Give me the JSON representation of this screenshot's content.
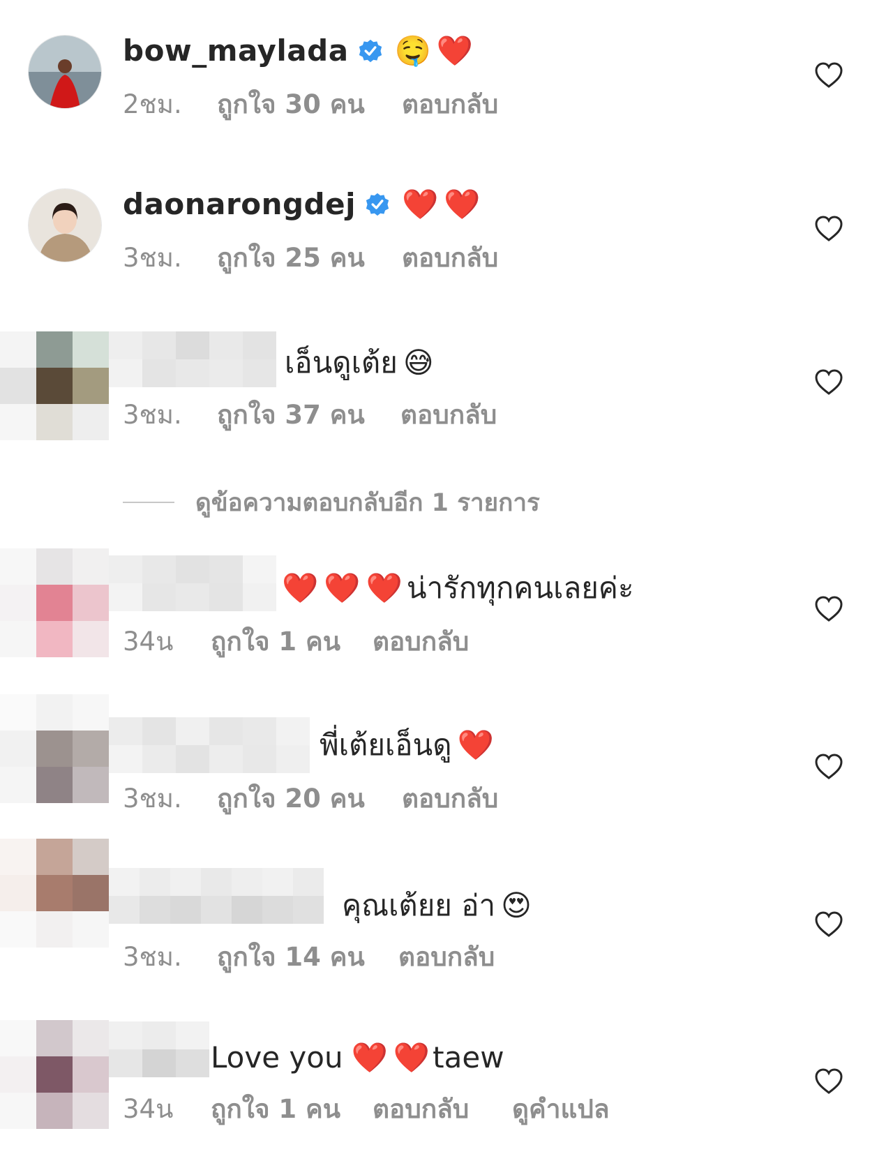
{
  "colors": {
    "verified_badge": "#3897f0",
    "heart_red": "#ed1c2e",
    "meta_gray": "#8e8e8e"
  },
  "comments": [
    {
      "username": "bow_maylada",
      "verified": true,
      "text": "",
      "emoji": [
        "🤤",
        "❤️"
      ],
      "time": "2ชม.",
      "likes": "ถูกใจ 30 คน",
      "reply": "ตอบกลับ",
      "like_icon": "heart-outline-icon"
    },
    {
      "username": "daonarongdej",
      "verified": true,
      "text": "",
      "emoji": [
        "❤️",
        "❤️"
      ],
      "time": "3ชม.",
      "likes": "ถูกใจ 25 คน",
      "reply": "ตอบกลับ",
      "like_icon": "heart-outline-icon"
    },
    {
      "username": "",
      "text": "เอ็นดูเต้ย",
      "emoji": [
        "😅"
      ],
      "time": "3ชม.",
      "likes": "ถูกใจ 37 คน",
      "reply": "ตอบกลับ",
      "like_icon": "heart-outline-icon"
    },
    {
      "username": "",
      "text": "น่ารักทุกคนเลยค่ะ",
      "emoji_before": [
        "❤️",
        "❤️",
        "❤️"
      ],
      "time": "34น",
      "likes": "ถูกใจ 1 คน",
      "reply": "ตอบกลับ",
      "like_icon": "heart-outline-icon"
    },
    {
      "username": "",
      "text": "พี่เต้ยเอ็นดู",
      "emoji": [
        "❤️"
      ],
      "time": "3ชม.",
      "likes": "ถูกใจ 20 คน",
      "reply": "ตอบกลับ",
      "like_icon": "heart-outline-icon"
    },
    {
      "username": "",
      "text": "คุณเต้ยย อ่า",
      "emoji": [
        "😍"
      ],
      "time": "3ชม.",
      "likes": "ถูกใจ 14 คน",
      "reply": "ตอบกลับ",
      "like_icon": "heart-outline-icon"
    },
    {
      "username": "",
      "text_a": "Love you",
      "emoji": [
        "❤️",
        "❤️"
      ],
      "text_b": "taew",
      "time": "34น",
      "likes": "ถูกใจ 1 คน",
      "reply": "ตอบกลับ",
      "translate": "ดูคำแปล",
      "like_icon": "heart-outline-icon"
    }
  ],
  "view_replies": "ดูข้อความตอบกลับอีก 1 รายการ"
}
